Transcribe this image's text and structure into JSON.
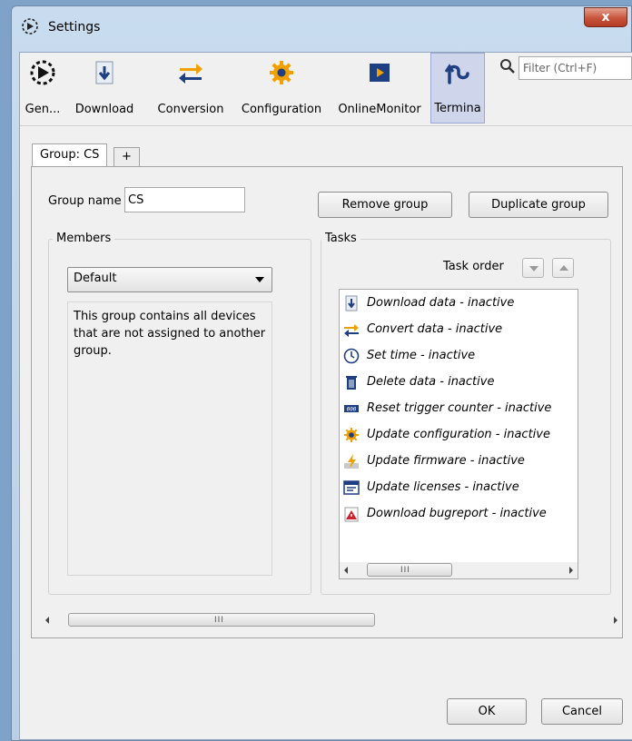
{
  "window": {
    "title": "Settings"
  },
  "titlebar": {
    "close_label": "x"
  },
  "toolbar": {
    "items": [
      {
        "label": "Gen...",
        "icon": "general-icon",
        "selected": false
      },
      {
        "label": "Download",
        "icon": "download-icon",
        "selected": false
      },
      {
        "label": "Conversion",
        "icon": "conversion-icon",
        "selected": false
      },
      {
        "label": "Configuration",
        "icon": "configuration-gear-icon",
        "selected": false
      },
      {
        "label": "OnlineMonitor",
        "icon": "online-monitor-icon",
        "selected": false
      },
      {
        "label": "Termina",
        "icon": "terminal-icon",
        "selected": true
      }
    ],
    "filter_placeholder": "Filter (Ctrl+F)"
  },
  "tabs": [
    {
      "label": "Group: CS",
      "active": true
    },
    {
      "label": "+",
      "active": false
    }
  ],
  "group": {
    "name_label": "Group name",
    "name_value": "CS",
    "remove_label": "Remove group",
    "duplicate_label": "Duplicate group"
  },
  "members": {
    "title": "Members",
    "selected": "Default",
    "description": "This group contains all devices that are not assigned to another group."
  },
  "tasks": {
    "title": "Tasks",
    "order_label": "Task order",
    "items": [
      {
        "label": "Download data - inactive",
        "icon": "download-icon"
      },
      {
        "label": "Convert data - inactive",
        "icon": "convert-icon"
      },
      {
        "label": "Set time - inactive",
        "icon": "clock-icon"
      },
      {
        "label": "Delete data - inactive",
        "icon": "trash-icon"
      },
      {
        "label": "Reset trigger counter - inactive",
        "icon": "counter-icon"
      },
      {
        "label": "Update configuration - inactive",
        "icon": "gear-icon"
      },
      {
        "label": "Update firmware - inactive",
        "icon": "firmware-icon"
      },
      {
        "label": "Update licenses - inactive",
        "icon": "license-icon"
      },
      {
        "label": "Download bugreport - inactive",
        "icon": "bugreport-icon"
      }
    ]
  },
  "scrollbar": {
    "grip": "III"
  },
  "footer": {
    "ok_label": "OK",
    "cancel_label": "Cancel"
  },
  "colors": {
    "accent_blue": "#1e3f82",
    "accent_orange": "#f0a000",
    "selection": "#cfd6ec"
  }
}
